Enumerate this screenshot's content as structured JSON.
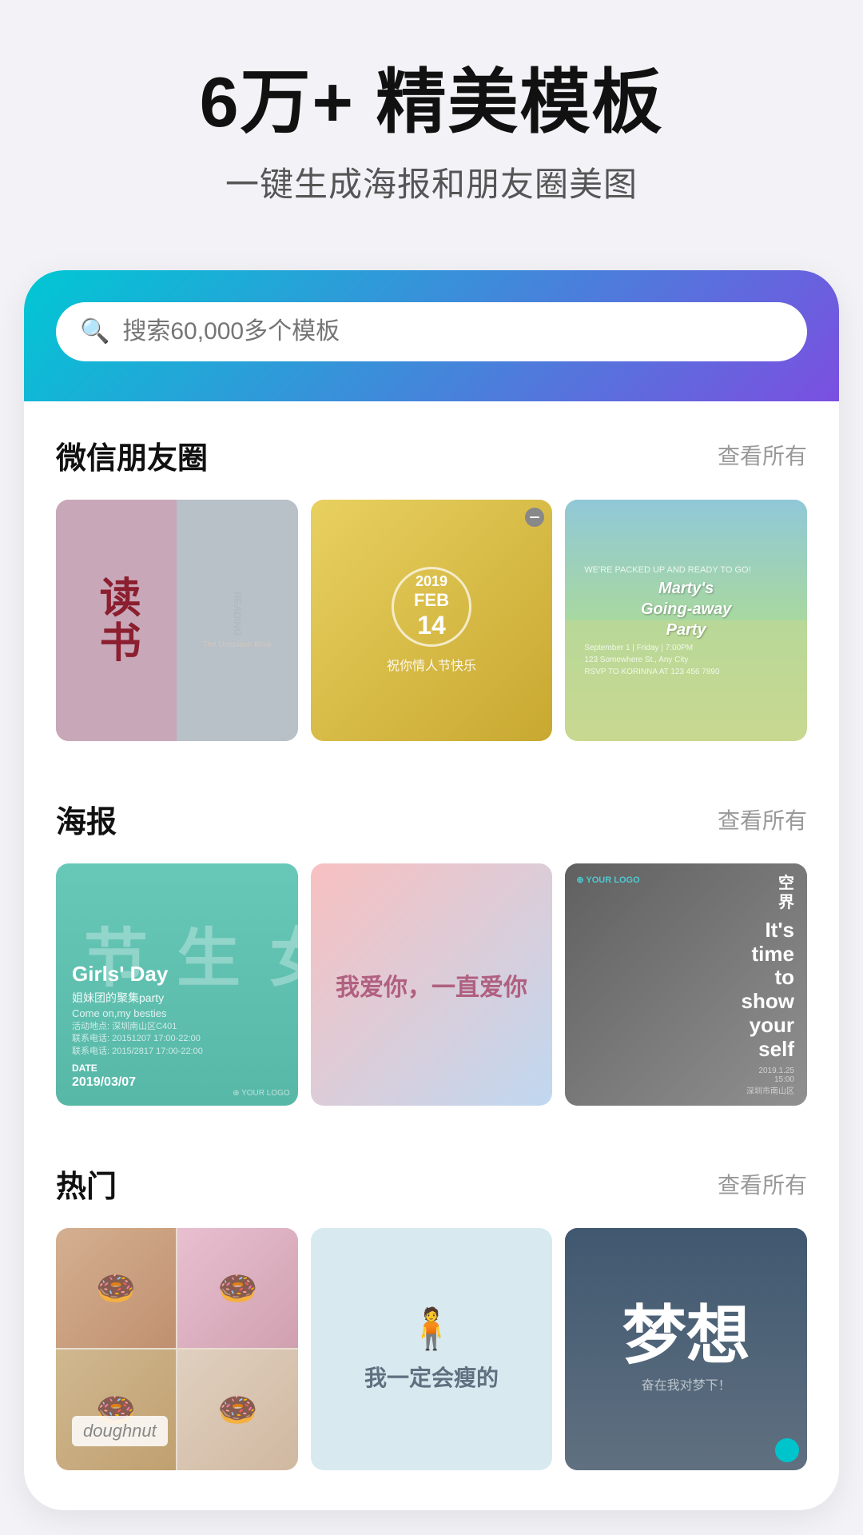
{
  "hero": {
    "title": "6万+  精美模板",
    "subtitle": "一键生成海报和朋友圈美图"
  },
  "search": {
    "placeholder": "搜索60,000多个模板"
  },
  "sections": [
    {
      "id": "wechat",
      "title": "微信朋友圈",
      "more_label": "查看所有",
      "cards": [
        {
          "id": "wechat-reading",
          "label": "读书"
        },
        {
          "id": "wechat-valentine",
          "label": "2019 FEB 14"
        },
        {
          "id": "wechat-party",
          "label": "Marty's Going-away Party"
        }
      ]
    },
    {
      "id": "poster",
      "title": "海报",
      "more_label": "查看所有",
      "cards": [
        {
          "id": "poster-girls-day",
          "label": "Girls' Day"
        },
        {
          "id": "poster-love",
          "label": "我爱你，一直爱你"
        },
        {
          "id": "poster-show",
          "label": "It's time to show yourself"
        }
      ]
    },
    {
      "id": "hot",
      "title": "热门",
      "more_label": "查看所有",
      "cards": [
        {
          "id": "hot-doughnut",
          "label": "doughnut"
        },
        {
          "id": "hot-motivation",
          "label": "我一定会瘦的"
        },
        {
          "id": "hot-dream",
          "label": "梦想"
        }
      ]
    }
  ]
}
